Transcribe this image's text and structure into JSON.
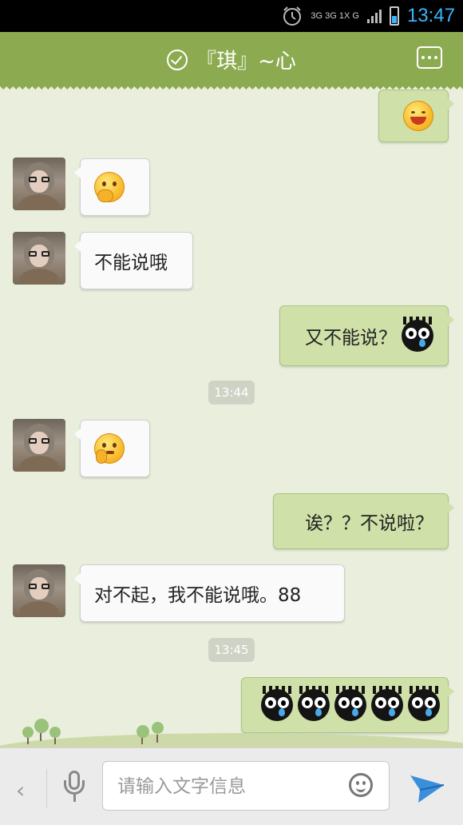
{
  "status_bar": {
    "network_top": "3G 3G 1X G",
    "time": "13:47"
  },
  "header": {
    "title": "『琪』~心"
  },
  "messages": [
    {
      "side": "right",
      "emoji": "laughing"
    },
    {
      "side": "left",
      "emoji": "giggling"
    },
    {
      "side": "left",
      "text": "不能说哦"
    },
    {
      "side": "right",
      "text": "又不能说？",
      "emoji": "crying-black"
    },
    {
      "timestamp": "13:44"
    },
    {
      "side": "left",
      "emoji": "thinking"
    },
    {
      "side": "right",
      "text": "诶？？不说啦？"
    },
    {
      "side": "left",
      "text": "对不起，我不能说哦。88"
    },
    {
      "timestamp": "13:45"
    },
    {
      "side": "right",
      "emoji_count": 5,
      "emoji": "crying-black"
    }
  ],
  "input_bar": {
    "placeholder": "请输入文字信息"
  },
  "colors": {
    "header": "#8caa4f",
    "background": "#e9efdc",
    "bubble_right": "#cfe0a8",
    "bubble_left": "#fafafa",
    "time_accent": "#38b6ff",
    "send_icon": "#3a8fdc"
  }
}
